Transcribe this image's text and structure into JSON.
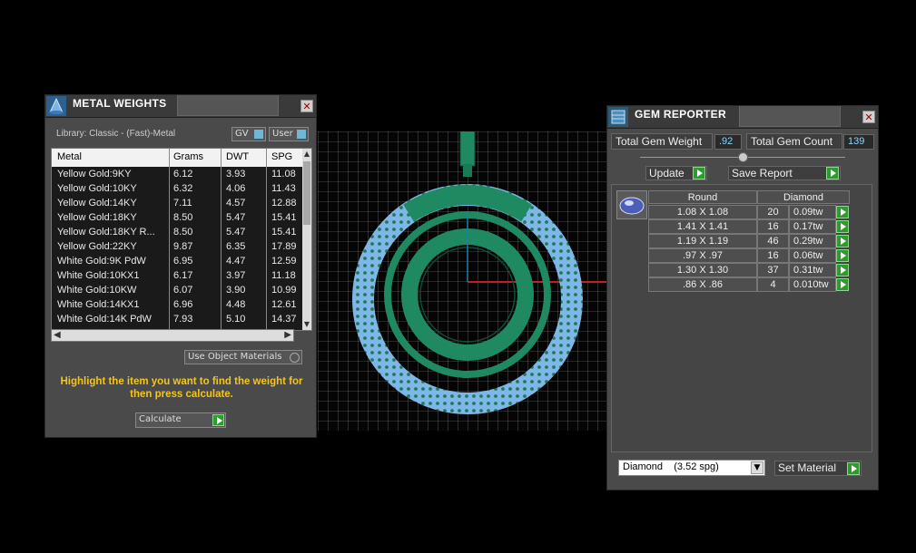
{
  "metal_panel": {
    "title": "METAL WEIGHTS",
    "library": "Library: Classic - (Fast)-Metal",
    "gv_label": "GV",
    "user_label": "User",
    "columns": [
      "Metal",
      "Grams",
      "DWT",
      "SPG"
    ],
    "rows": [
      {
        "metal": "Yellow Gold:9KY",
        "grams": "6.12",
        "dwt": "3.93",
        "spg": "11.08"
      },
      {
        "metal": "Yellow Gold:10KY",
        "grams": "6.32",
        "dwt": "4.06",
        "spg": "11.43"
      },
      {
        "metal": "Yellow Gold:14KY",
        "grams": "7.11",
        "dwt": "4.57",
        "spg": "12.88"
      },
      {
        "metal": "Yellow Gold:18KY",
        "grams": "8.50",
        "dwt": "5.47",
        "spg": "15.41"
      },
      {
        "metal": "Yellow Gold:18KY R...",
        "grams": "8.50",
        "dwt": "5.47",
        "spg": "15.41"
      },
      {
        "metal": "Yellow Gold:22KY",
        "grams": "9.87",
        "dwt": "6.35",
        "spg": "17.89"
      },
      {
        "metal": "White Gold:9K PdW",
        "grams": "6.95",
        "dwt": "4.47",
        "spg": "12.59"
      },
      {
        "metal": "White Gold:10KX1",
        "grams": "6.17",
        "dwt": "3.97",
        "spg": "11.18"
      },
      {
        "metal": "White Gold:10KW",
        "grams": "6.07",
        "dwt": "3.90",
        "spg": "10.99"
      },
      {
        "metal": "White Gold:14KX1",
        "grams": "6.96",
        "dwt": "4.48",
        "spg": "12.61"
      },
      {
        "metal": "White Gold:14K PdW",
        "grams": "7.93",
        "dwt": "5.10",
        "spg": "14.37"
      }
    ],
    "use_object_materials": "Use Object Materials",
    "instruction": "Highlight the item you want to find the weight for then press calculate.",
    "calculate_label": "Calculate"
  },
  "gem_panel": {
    "title": "GEM REPORTER",
    "total_weight_label": "Total Gem Weight",
    "total_weight_value": ".92",
    "total_count_label": "Total Gem Count",
    "total_count_value": "139",
    "update_label": "Update",
    "save_report_label": "Save Report",
    "col_shape": "Round",
    "col_material": "Diamond",
    "rows": [
      {
        "size": "1.08 X 1.08",
        "count": "20",
        "weight": "0.09tw"
      },
      {
        "size": "1.41 X 1.41",
        "count": "16",
        "weight": "0.17tw"
      },
      {
        "size": "1.19 X 1.19",
        "count": "46",
        "weight": "0.29tw"
      },
      {
        "size": ".97 X .97",
        "count": "16",
        "weight": "0.06tw"
      },
      {
        "size": "1.30 X 1.30",
        "count": "37",
        "weight": "0.31tw"
      },
      {
        "size": ".86 X .86",
        "count": "4",
        "weight": "0.010tw"
      }
    ],
    "material_select": "Diamond    (3.52 spg)",
    "set_material_label": "Set Material"
  },
  "colors": {
    "model_green": "#1f8a62",
    "gem_blue": "#7fb6e8",
    "instruction_yellow": "#f5c518",
    "value_cyan": "#7fd8ff"
  }
}
